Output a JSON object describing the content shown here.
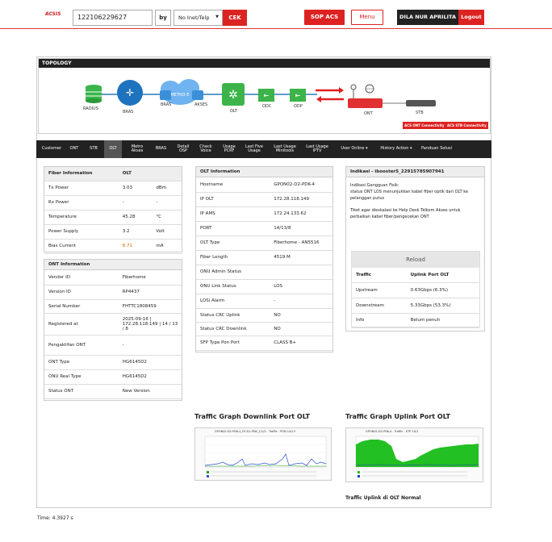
{
  "header": {
    "logo": "ACSIS",
    "search_value": "122106229627",
    "by_label": "by",
    "search_type": "No Inet/Telp",
    "cek_label": "CEK",
    "sop_label": "SOP ACS",
    "menu_label": "Menu",
    "user_name": "DILA NUR APRILITA",
    "logout_label": "Logout"
  },
  "topology": {
    "title": "TOPOLOGY",
    "nodes": [
      "RADIUS",
      "BRAS",
      "BRAS",
      "AKSES",
      "OLT",
      "ODC",
      "ODP",
      "ONT",
      "STB"
    ],
    "cloud_text": "METRO-E",
    "badges": [
      "ACS ONT Connectivity",
      "ACS STB Connectivity"
    ]
  },
  "tabs": [
    "Customer",
    "ONT",
    "STB",
    "OLT",
    "Metro Akses",
    "BRAS",
    "Detail OSP",
    "Check Voice",
    "Usage PCRF",
    "Last Five Usage",
    "Last Usage Minitools",
    "Last Usage IPTV",
    "User Online ▾",
    "History Action ▾",
    "Panduan Solusi"
  ],
  "fiber": {
    "title": "Fiber Information",
    "col": "OLT",
    "rows": [
      {
        "k": "Tx Power",
        "v": "3.03",
        "u": "dBm"
      },
      {
        "k": "Rx Power",
        "v": "-",
        "u": "-"
      },
      {
        "k": "Temperature",
        "v": "45.28",
        "u": "°C"
      },
      {
        "k": "Power Supply",
        "v": "3.2",
        "u": "Volt"
      },
      {
        "k": "Bias Current",
        "v": "8.71",
        "u": "mA"
      }
    ]
  },
  "ont": {
    "title": "ONT Information",
    "rows": [
      {
        "k": "Vendor ID",
        "v": "Fiberhome"
      },
      {
        "k": "Version ID",
        "v": "RP4437"
      },
      {
        "k": "Serial Number",
        "v": "FHTTC1808459"
      },
      {
        "k": "Registered at",
        "v": "2025-09-16 | 172.28.118.149 | 14 / 13 / 8"
      },
      {
        "k": "Pengaktifan ONT",
        "v": "-"
      },
      {
        "k": "ONT Type",
        "v": "HG6145D2"
      },
      {
        "k": "ONU Real Type",
        "v": "HG6145D2"
      },
      {
        "k": "Status ONT",
        "v": "New Version"
      }
    ]
  },
  "olt": {
    "title": "OLT Information",
    "rows": [
      {
        "k": "Hostname",
        "v": "GPON02-D2-PDK-4"
      },
      {
        "k": "IP OLT",
        "v": "172.28.118.149"
      },
      {
        "k": "IP AMS",
        "v": "172.24.133.62"
      },
      {
        "k": "PORT",
        "v": "14/13/8"
      },
      {
        "k": "OLT Type",
        "v": "Fiberhome - AN5516"
      },
      {
        "k": "Fiber Length",
        "v": "4519 M"
      },
      {
        "k": "ONU Admin Status",
        "v": ""
      },
      {
        "k": "ONU Link Status",
        "v": "LOS"
      },
      {
        "k": "LOSi Alarm",
        "v": "-"
      },
      {
        "k": "Status CRC Uplink",
        "v": "NO"
      },
      {
        "k": "Status CRC Downlink",
        "v": "NO"
      },
      {
        "k": "SFP Type Pon Port",
        "v": "CLASS B+"
      }
    ]
  },
  "indikasi": {
    "title": "Indikasi - iboosterS_22915785907941",
    "line1": "Indikasi Gangguan Fisik:",
    "line2": "status ONT LOS menunjukkan kabel fiber optik dari OLT ke pelanggan putus",
    "line3": "Tiket agar dieskalasi ke Help Desk Telkom Akses untuk perbaikan kabel fiber/pengecekan ONT",
    "reload": "Reload",
    "traffic_head": [
      "Traffic",
      "Uplink Port OLT"
    ],
    "traffic_rows": [
      {
        "k": "Upstream",
        "v": "0.63Gbps (6.3%)"
      },
      {
        "k": "Downstream",
        "v": "5.33Gbps (53.3%)"
      },
      {
        "k": "Info",
        "v": "Belum penuh"
      }
    ]
  },
  "graphs": {
    "downlink_title": "Traffic Graph Downlink Port OLT",
    "uplink_title": "Traffic Graph Uplink Port OLT",
    "downlink_caption": "GPON02-D2-PDK-4_FE-D1-PDK_1/1/2 - Traffic - PON 14/13",
    "uplink_caption": "GPON02-D2-PDK-4 - Traffic - XTP 10/1",
    "uplink_footer": "Traffic Uplink di OLT Normal"
  },
  "footer": {
    "time": "Time: 4.3927 s"
  }
}
